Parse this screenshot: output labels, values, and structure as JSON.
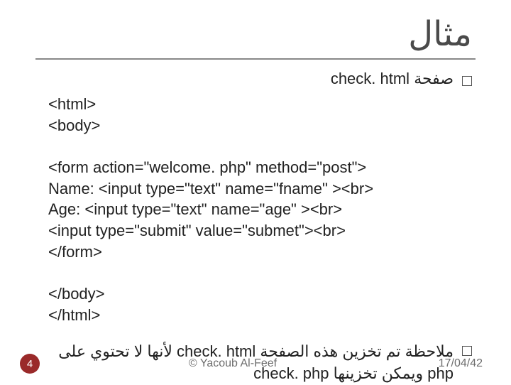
{
  "title": "مثال",
  "bullet1": "صفحة check. html",
  "code_block": "<html>\n<body>\n\n<form action=\"welcome. php\" method=\"post\">\nName: <input type=\"text\" name=\"fname\" ><br>\nAge: <input type=\"text\" name=\"age\" ><br>\n<input type=\"submit\" value=\"submet\"><br>\n</form>\n\n</body>\n</html>",
  "note_text": "ملاحظة تم تخزين هذه الصفحة  check. html      لأنها       لا تحتوي على php \nويمكن تخزينها  check. php",
  "footer": {
    "page": "4",
    "author": "© Yacoub Al-Feef",
    "date": "17/04/42"
  }
}
